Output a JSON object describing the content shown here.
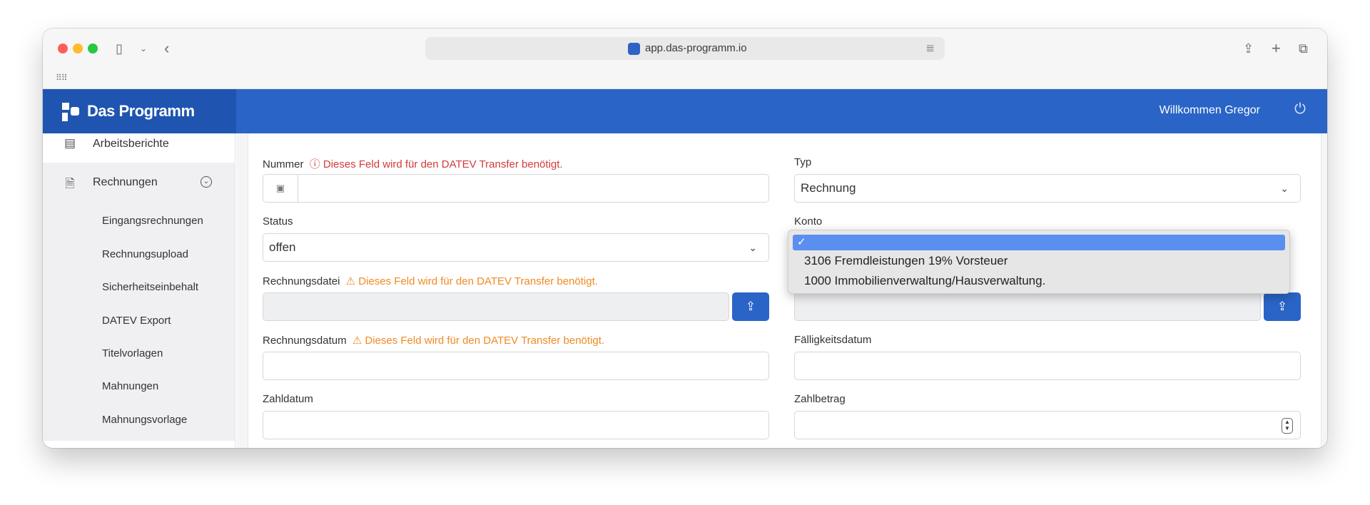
{
  "browser": {
    "url": "app.das-programm.io"
  },
  "app": {
    "brand": "Das Programm",
    "welcome": "Willkommen Gregor"
  },
  "sidebar": {
    "items": [
      {
        "label": "Arbeitsberichte"
      },
      {
        "label": "Rechnungen"
      }
    ],
    "subitems": [
      {
        "label": "Eingangsrechnungen"
      },
      {
        "label": "Rechnungsupload"
      },
      {
        "label": "Sicherheitseinbehalt"
      },
      {
        "label": "DATEV Export"
      },
      {
        "label": "Titelvorlagen"
      },
      {
        "label": "Mahnungen"
      },
      {
        "label": "Mahnungsvorlage"
      }
    ]
  },
  "form": {
    "nummer": {
      "label": "Nummer",
      "warning": "Dieses Feld wird für den DATEV Transfer benötigt.",
      "value": ""
    },
    "typ": {
      "label": "Typ",
      "value": "Rechnung"
    },
    "status": {
      "label": "Status",
      "value": "offen"
    },
    "konto": {
      "label": "Konto",
      "value": ""
    },
    "rechnungsdatei": {
      "label": "Rechnungsdatei",
      "warning": "Dieses Feld wird für den DATEV Transfer benötigt."
    },
    "rechnungsdatum": {
      "label": "Rechnungsdatum",
      "warning": "Dieses Feld wird für den DATEV Transfer benötigt."
    },
    "faelligkeitsdatum": {
      "label": "Fälligkeitsdatum"
    },
    "zahldatum": {
      "label": "Zahldatum"
    },
    "zahlbetrag": {
      "label": "Zahlbetrag"
    }
  },
  "konto_dropdown": {
    "options": [
      {
        "label": "",
        "selected": true
      },
      {
        "label": "3106 Fremdleistungen 19% Vorsteuer"
      },
      {
        "label": "1000 Immobilienverwaltung/Hausverwaltung."
      }
    ]
  },
  "colors": {
    "header": "#2a64c6",
    "brand": "#1f55b0",
    "warning_red": "#d23b3b",
    "warning_orange": "#f08a24"
  }
}
